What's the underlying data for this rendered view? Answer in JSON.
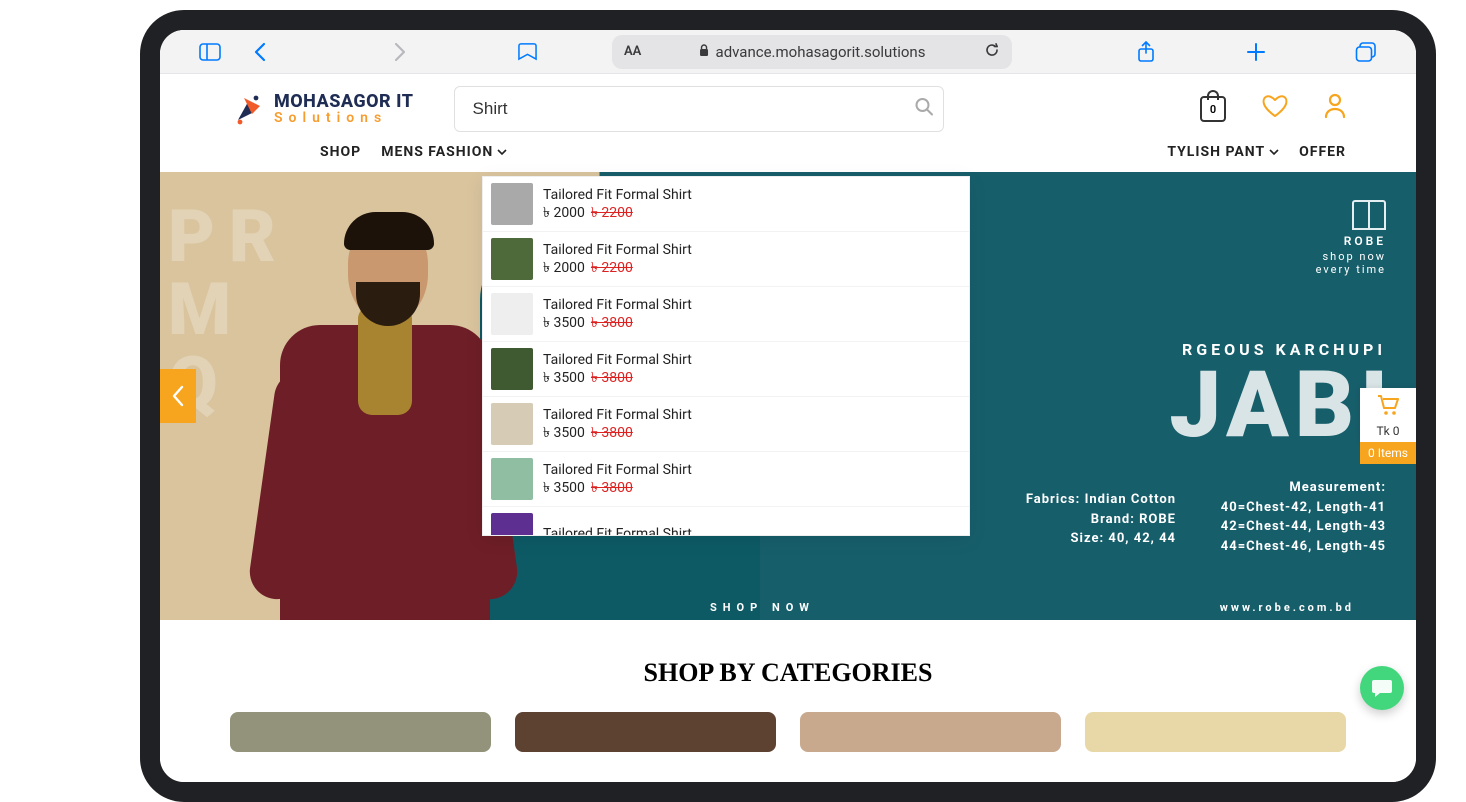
{
  "browser": {
    "aa_label": "AA",
    "url_domain": "advance.mohasagorit.solutions"
  },
  "logo": {
    "line1": "MOHASAGOR IT",
    "line2": "Solutions"
  },
  "search": {
    "value": "Shirt"
  },
  "header_icons": {
    "bag_count": "0"
  },
  "nav": {
    "shop": "SHOP",
    "mens": "MENS FASHION",
    "stylish": "TYLISH PANT",
    "offer": "OFFER"
  },
  "dropdown": [
    {
      "title": "Tailored Fit Formal Shirt",
      "price": "৳ 2000",
      "old": "৳ 2200",
      "thumb": "#a9a9a9"
    },
    {
      "title": "Tailored Fit Formal Shirt",
      "price": "৳ 2000",
      "old": "৳ 2200",
      "thumb": "#4e6a3a"
    },
    {
      "title": "Tailored Fit Formal Shirt",
      "price": "৳ 3500",
      "old": "৳ 3800",
      "thumb": "#eeeeee"
    },
    {
      "title": "Tailored Fit Formal Shirt",
      "price": "৳ 3500",
      "old": "৳ 3800",
      "thumb": "#3f5a30"
    },
    {
      "title": "Tailored Fit Formal Shirt",
      "price": "৳ 3500",
      "old": "৳ 3800",
      "thumb": "#d6cbb5"
    },
    {
      "title": "Tailored Fit Formal Shirt",
      "price": "৳ 3500",
      "old": "৳ 3800",
      "thumb": "#8fbea2"
    },
    {
      "title": "Tailored Fit Formal Shirt",
      "price": "",
      "old": "",
      "thumb": "#5d2f91"
    }
  ],
  "hero": {
    "brand": "ROBE",
    "brand_t1": "shop now",
    "brand_t2": "every time",
    "headline_small": "RGEOUS KARCHUPI",
    "headline_big": "JABI",
    "spec_left_lines": [
      "Fabrics: Indian Cotton",
      "Brand: ROBE",
      "Size: 40, 42, 44"
    ],
    "spec_right_lines": [
      "Measurement:",
      "40=Chest-42, Length-41",
      "42=Chest-44, Length-43",
      "44=Chest-46, Length-45"
    ],
    "shopnow": "SHOP NOW",
    "url": "www.robe.com.bd",
    "bgtext": [
      "PR",
      "M",
      "Q"
    ]
  },
  "minicart": {
    "amount": "Tk 0",
    "items": "0 Items"
  },
  "sections": {
    "categories_heading": "SHOP BY CATEGORIES"
  }
}
